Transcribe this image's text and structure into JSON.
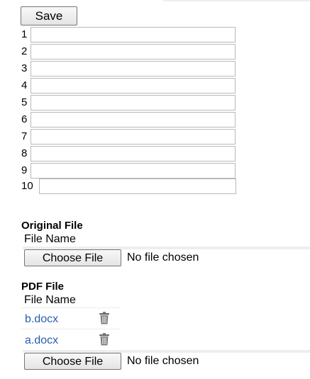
{
  "toolbar": {
    "save_label": "Save"
  },
  "rows": [
    {
      "number": "1",
      "value": ""
    },
    {
      "number": "2",
      "value": ""
    },
    {
      "number": "3",
      "value": ""
    },
    {
      "number": "4",
      "value": ""
    },
    {
      "number": "5",
      "value": ""
    },
    {
      "number": "6",
      "value": ""
    },
    {
      "number": "7",
      "value": ""
    },
    {
      "number": "8",
      "value": ""
    },
    {
      "number": "9",
      "value": ""
    },
    {
      "number": "10",
      "value": ""
    }
  ],
  "original_file": {
    "title": "Original File",
    "column_header": "File Name",
    "choose_label": "Choose File",
    "status": "No file chosen"
  },
  "pdf_file": {
    "title": "PDF File",
    "column_header": "File Name",
    "files": [
      {
        "name": "b.docx",
        "icon": "trash-icon"
      },
      {
        "name": "a.docx",
        "icon": "trash-icon"
      }
    ],
    "choose_label": "Choose File",
    "status": "No file chosen"
  },
  "colors": {
    "link": "#2a5db0",
    "border": "#b9b9b9",
    "icon": "#6b6b6b"
  }
}
